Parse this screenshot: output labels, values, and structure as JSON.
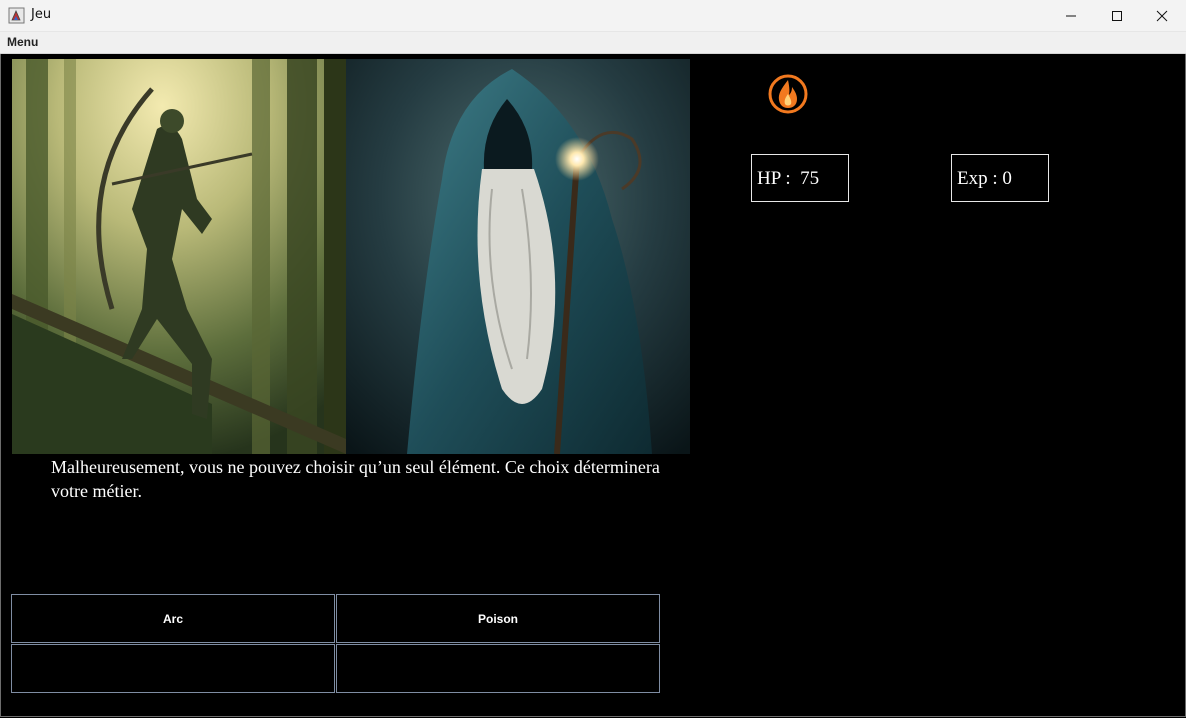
{
  "window": {
    "title": "Jeu"
  },
  "menubar": {
    "menu_label": "Menu"
  },
  "story": {
    "text": "Malheureusement, vous ne pouvez choisir qu’un seul élément. Ce choix déterminera votre métier."
  },
  "stats": {
    "hp_text": "HP :  75",
    "exp_text": "Exp : 0"
  },
  "element_icon": "fire-icon",
  "choices": [
    {
      "label": "Arc"
    },
    {
      "label": "Poison"
    },
    {
      "label": ""
    },
    {
      "label": ""
    }
  ],
  "colors": {
    "background": "#000000",
    "fire_orange": "#f2791f",
    "button_border": "#7f8da3"
  }
}
